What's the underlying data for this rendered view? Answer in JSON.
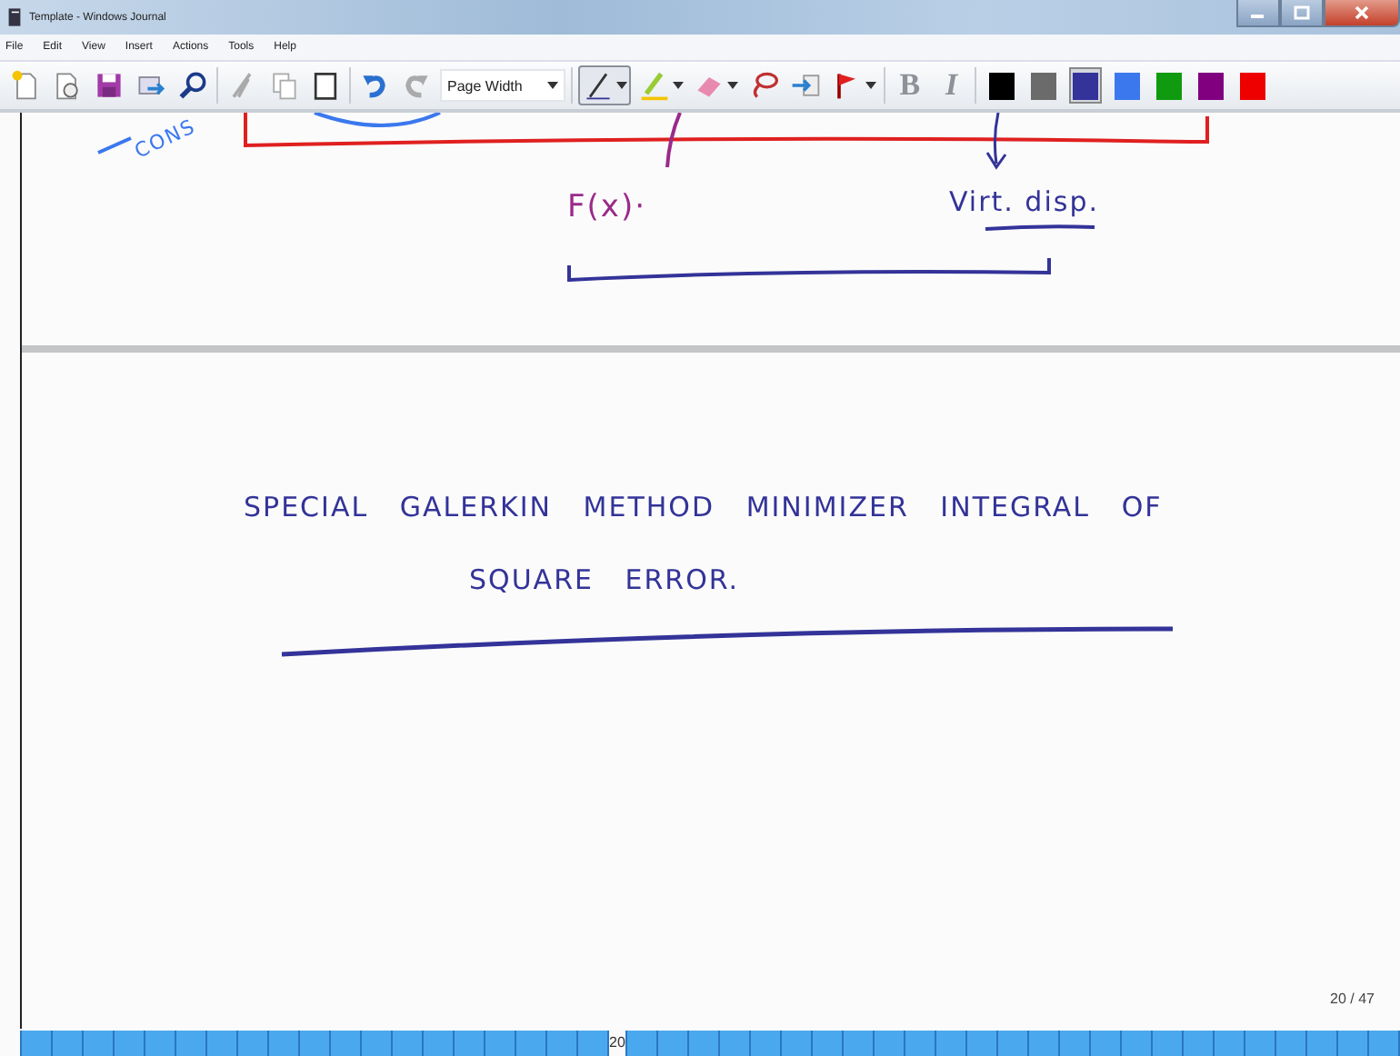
{
  "window": {
    "title": "Template - Windows Journal"
  },
  "menu": [
    "File",
    "Edit",
    "View",
    "Insert",
    "Actions",
    "Tools",
    "Help"
  ],
  "toolbar": {
    "zoom": "Page Width",
    "bold": {
      "label": "B",
      "disabled": true
    },
    "italic": {
      "label": "I",
      "disabled": true
    },
    "colors": [
      {
        "color": "#000000",
        "selected": false
      },
      {
        "color": "#6b6b6b",
        "selected": false
      },
      {
        "color": "#333399",
        "selected": true
      },
      {
        "color": "#3b78ee",
        "selected": false
      },
      {
        "color": "#109a10",
        "selected": false
      },
      {
        "color": "#800080",
        "selected": false
      },
      {
        "color": "#ee0000",
        "selected": false
      }
    ]
  },
  "ink": [
    {
      "text": "CONS",
      "color": "#3b78ee"
    },
    {
      "text": "F(x)·",
      "color": "#9a2a8a"
    },
    {
      "text": "Virt. disp.",
      "color": "#333399"
    },
    {
      "text": "SPECIAL   GALERKIN   METHOD   MINIMIZER   INTEGRAL   OF",
      "color": "#333399"
    },
    {
      "text": "SQUARE   ERROR.",
      "color": "#333399"
    }
  ],
  "page_counter": "20 / 47",
  "page_tabs": {
    "current": "20"
  }
}
